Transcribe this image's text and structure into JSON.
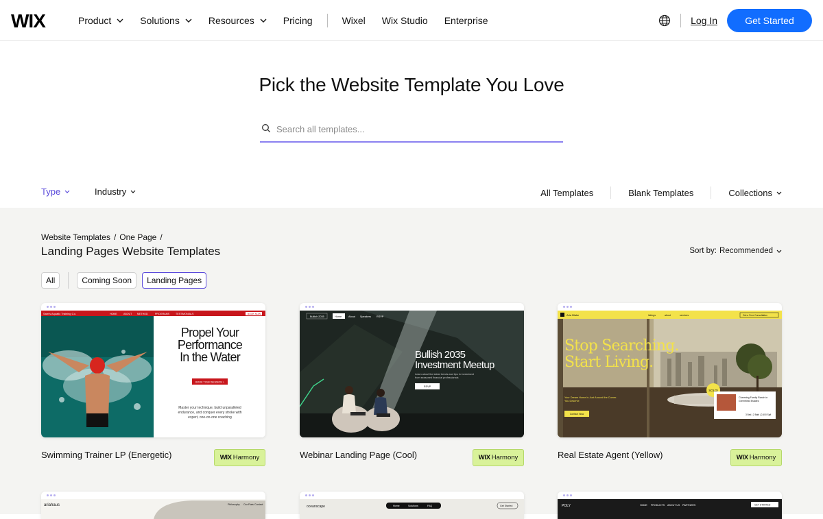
{
  "header": {
    "logo": "WIX",
    "nav": [
      {
        "label": "Product",
        "dropdown": true
      },
      {
        "label": "Solutions",
        "dropdown": true
      },
      {
        "label": "Resources",
        "dropdown": true
      },
      {
        "label": "Pricing",
        "dropdown": false
      }
    ],
    "nav_secondary": [
      "Wixel",
      "Wix Studio",
      "Enterprise"
    ],
    "login": "Log In",
    "cta": "Get Started"
  },
  "hero": {
    "title": "Pick the Website Template You Love",
    "search_placeholder": "Search all templates..."
  },
  "filters": {
    "type": "Type",
    "industry": "Industry",
    "all_templates": "All Templates",
    "blank_templates": "Blank Templates",
    "collections": "Collections"
  },
  "listing": {
    "breadcrumb": [
      "Website Templates",
      "One Page"
    ],
    "breadcrumb_sep": "/",
    "title": "Landing Pages Website Templates",
    "sort_label": "Sort by:",
    "sort_value": "Recommended",
    "chips": [
      "All",
      "Coming Soon",
      "Landing Pages"
    ],
    "active_chip": "Landing Pages"
  },
  "badge": {
    "brand": "WIX",
    "label": "Harmony"
  },
  "cards": [
    {
      "name": "Swimming Trainer LP (Energetic)",
      "preview": {
        "brand": "Sam's Aquatic Training Co.",
        "menu": [
          "HOME",
          "ABOUT",
          "METHOD",
          "PROGRAMS",
          "TESTIMONIALS"
        ],
        "nav_button": "BOOK NOW",
        "heading": [
          "Propel Your",
          "Performance",
          "In the Water"
        ],
        "cta": "BOOK YOUR SESSION  >",
        "body": [
          "Master your technique, build unparalleled",
          "endurance, and conquer every stroke with",
          "expert, one-on-one coaching"
        ]
      }
    },
    {
      "name": "Webinar Landing Page (Cool)",
      "preview": {
        "brand": "Bullish 2035",
        "menu": [
          "Home",
          "About",
          "Speakers",
          "RSVP"
        ],
        "heading": [
          "Bullish 2035",
          "Investment Meetup"
        ],
        "body": [
          "Learn about the latest trends and tips in investment",
          "from seasoned financial professionals"
        ],
        "cta": "RSVP"
      }
    },
    {
      "name": "Real Estate Agent (Yellow)",
      "preview": {
        "brand": "Aria Blake",
        "menu": [
          "listings",
          "about",
          "services"
        ],
        "nav_button": "Get a Free Consultation",
        "heading": [
          "Stop Searching.",
          "Start Living."
        ],
        "body": [
          "Your Dream Home Is Just Around the Corner.",
          "You Deserve"
        ],
        "cta": "Contact Now",
        "sticker": "SOLD!",
        "listing_title": [
          "Charming Family Ranch in",
          "Greenfield Estates"
        ],
        "listing_meta": "3 Bed  |  2 Bath  |  2,400 Sqft"
      }
    }
  ],
  "cards_partial": [
    {
      "brand": "ariahaus",
      "menu": [
        "Philosophy",
        "Our Flats",
        "Contact"
      ]
    },
    {
      "brand": "oceanscape",
      "menu": [
        "Home",
        "Solutions",
        "FAQ"
      ],
      "nav_button": "Get Started"
    },
    {
      "brand": "POLY",
      "menu": [
        "HOME",
        "PRODUCTS",
        "ABOUT US",
        "PARTNERS"
      ],
      "nav_button": "GET STARTED"
    }
  ]
}
